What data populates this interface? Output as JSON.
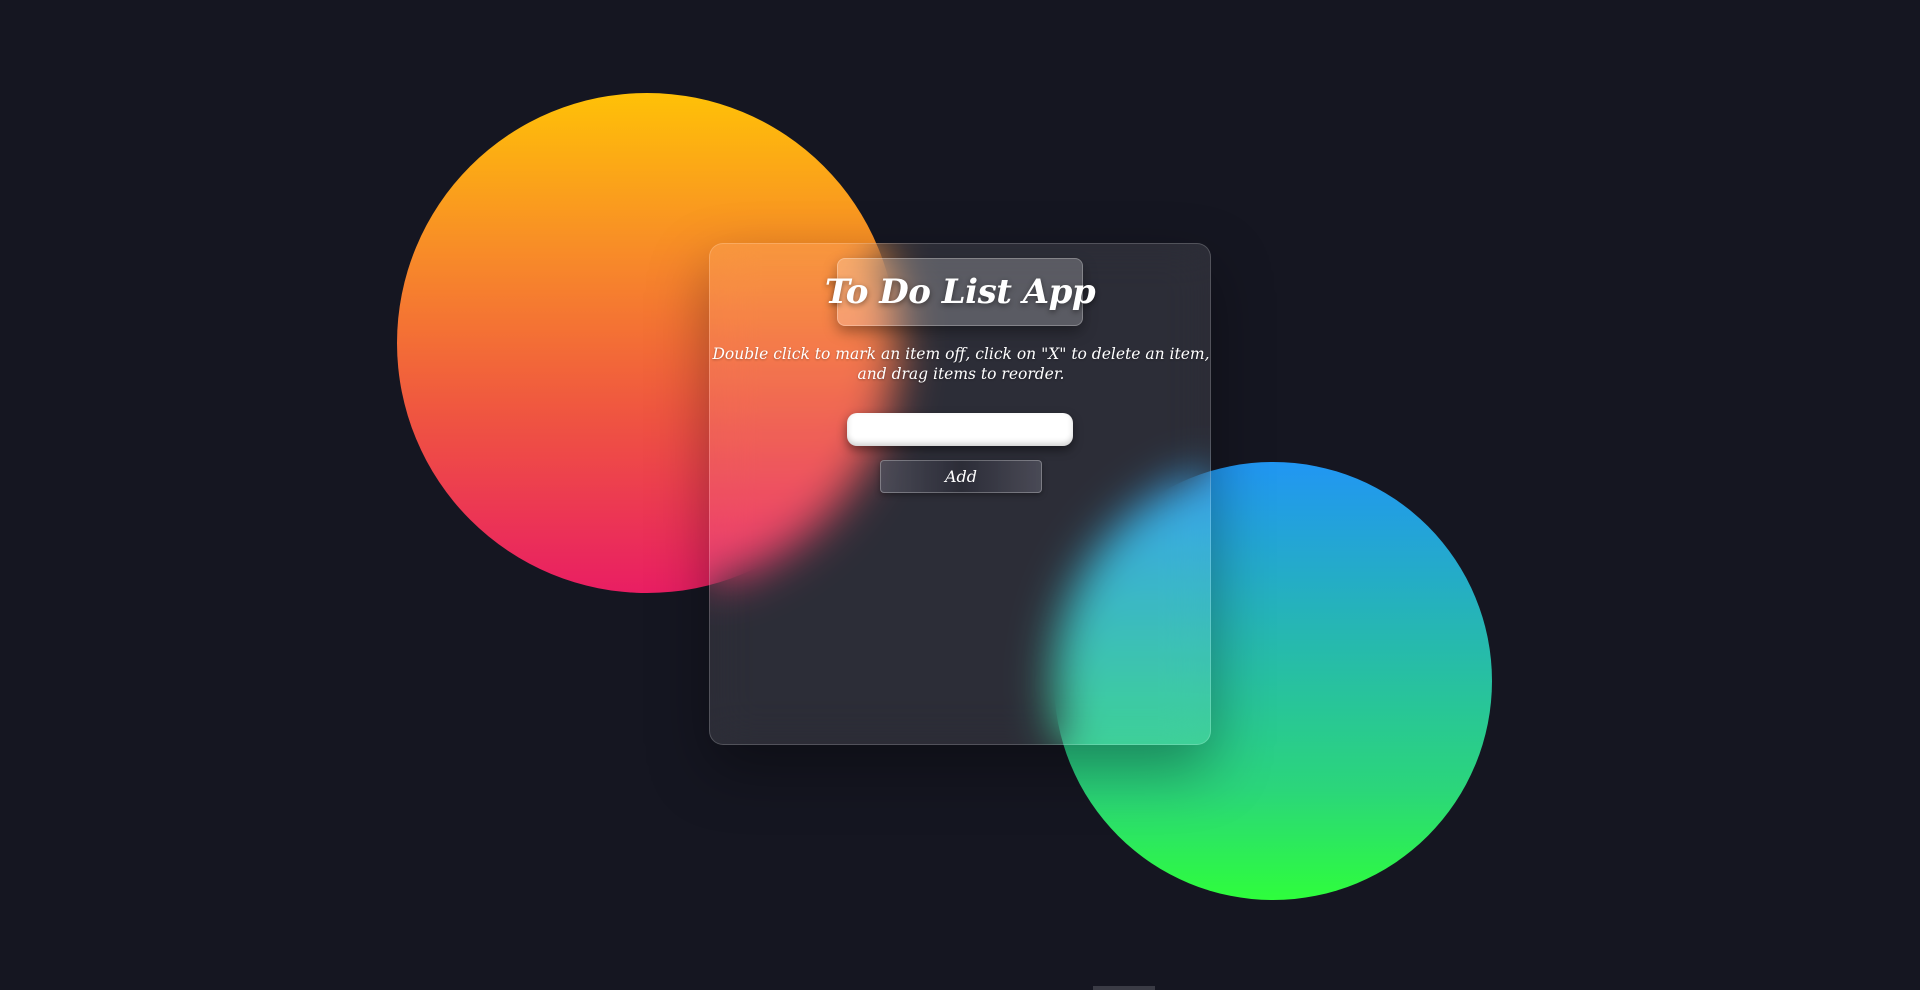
{
  "app": {
    "title": "To Do List App",
    "instructions": "Double click to mark an item off, click on \"X\" to delete an item, and drag items to reorder."
  },
  "form": {
    "input_value": "",
    "input_placeholder": "",
    "add_label": "Add"
  },
  "colors": {
    "background": "#151621",
    "warm_orb_top": "#ffc107",
    "warm_orb_bottom": "#e91e63",
    "cool_orb_top": "#2196f3",
    "cool_orb_bottom": "#2efe3c"
  }
}
